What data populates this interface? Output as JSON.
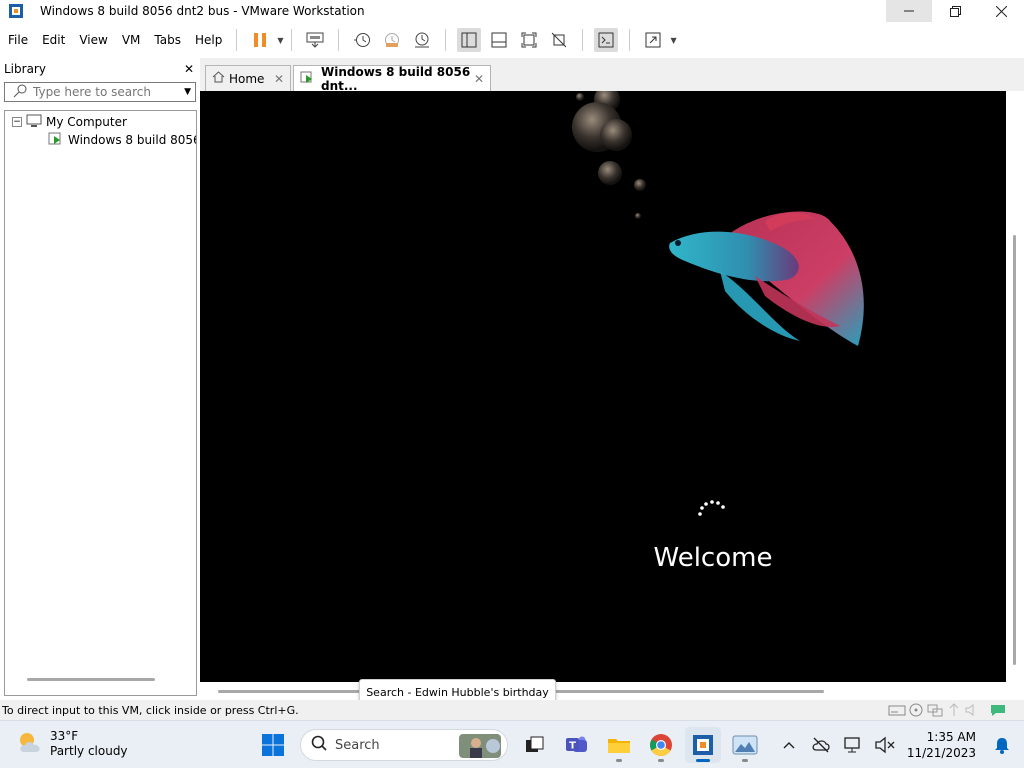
{
  "window": {
    "title": "Windows 8 build 8056 dnt2 bus - VMware Workstation"
  },
  "menu": [
    "File",
    "Edit",
    "View",
    "VM",
    "Tabs",
    "Help"
  ],
  "library": {
    "title": "Library",
    "search_placeholder": "Type here to search",
    "tree": {
      "root": "My Computer",
      "child": "Windows 8 build 8056 d"
    }
  },
  "tabs": [
    {
      "label": "Home"
    },
    {
      "label": "Windows 8 build 8056 dnt..."
    }
  ],
  "vm": {
    "welcome": "Welcome"
  },
  "tooltip": "Search - Edwin Hubble's birthday",
  "status": "To direct input to this VM, click inside or press Ctrl+G.",
  "taskbar": {
    "weather_temp": "33°F",
    "weather_desc": "Partly cloudy",
    "search_label": "Search",
    "time": "1:35 AM",
    "date": "11/21/2023"
  },
  "colors": {
    "pause": "#f28c28",
    "accent": "#0067c0",
    "vm_bg": "#000000"
  }
}
